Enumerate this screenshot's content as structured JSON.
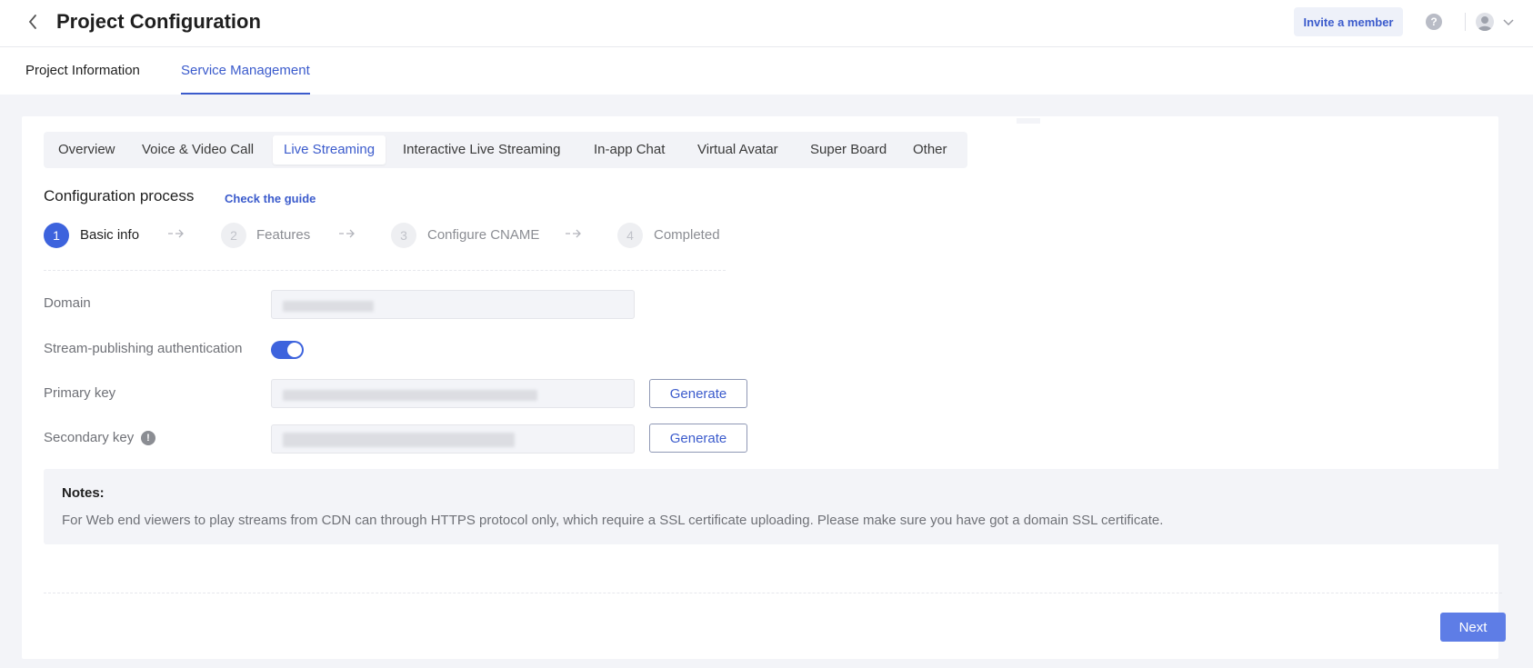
{
  "header": {
    "title": "Project Configuration",
    "invite_label": "Invite a member",
    "help_glyph": "?",
    "icons": {
      "back": "chevron-left-icon",
      "help": "help-icon",
      "avatar": "user-avatar-icon",
      "dropdown": "chevron-down-icon"
    }
  },
  "top_tabs": [
    {
      "label": "Project Information",
      "active": false
    },
    {
      "label": "Service Management",
      "active": true
    }
  ],
  "service_tabs": [
    {
      "label": "Overview",
      "active": false
    },
    {
      "label": "Voice & Video Call",
      "active": false
    },
    {
      "label": "Live Streaming",
      "active": true
    },
    {
      "label": "Interactive Live Streaming",
      "active": false
    },
    {
      "label": "In-app Chat",
      "active": false
    },
    {
      "label": "Virtual Avatar",
      "active": false
    },
    {
      "label": "Super Board",
      "active": false
    },
    {
      "label": "Other",
      "active": false
    }
  ],
  "config": {
    "title": "Configuration process",
    "guide_link": "Check the guide",
    "steps": [
      {
        "number": "1",
        "label": "Basic info",
        "active": true
      },
      {
        "number": "2",
        "label": "Features",
        "active": false
      },
      {
        "number": "3",
        "label": "Configure CNAME",
        "active": false
      },
      {
        "number": "4",
        "label": "Completed",
        "active": false
      }
    ]
  },
  "form": {
    "domain_label": "Domain",
    "auth_label": "Stream-publishing authentication",
    "auth_enabled": true,
    "primary_key_label": "Primary key",
    "secondary_key_label": "Secondary key",
    "secondary_info_glyph": "!",
    "generate_label": "Generate"
  },
  "notes": {
    "title": "Notes:",
    "body": "For Web end viewers to play streams from CDN can through HTTPS protocol only, which require a SSL certificate uploading. Please make sure you have got a domain SSL certificate."
  },
  "footer": {
    "next_label": "Next"
  },
  "colors": {
    "accent": "#3b5bcc",
    "primary_button": "#5e7de6",
    "toggle_on": "#3d63dd",
    "page_bg": "#f3f4f8"
  }
}
